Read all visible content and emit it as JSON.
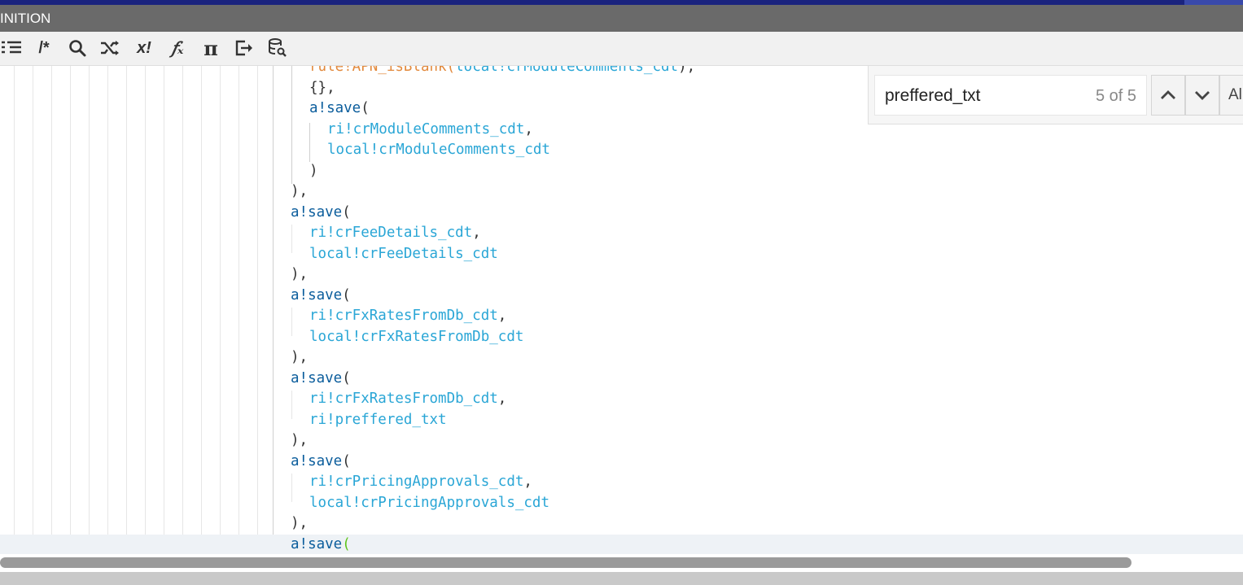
{
  "window": {
    "title": "INITION"
  },
  "toolbar": {
    "comment_label": "/*",
    "xbang_label": "x!",
    "fx_label": "𝑓ₓ",
    "pi_label": "π",
    "icons": [
      "outline-icon",
      "comment-icon",
      "search-icon",
      "shuffle-icon",
      "variable-icon",
      "function-icon",
      "pi-icon",
      "export-icon",
      "database-search-icon"
    ]
  },
  "find": {
    "query": "preffered_txt",
    "count": "5 of 5",
    "all_label": "All"
  },
  "editor": {
    "colors": {
      "keyword": "#0b5d9c",
      "variable": "#2aa6d6",
      "rule": "#e2893c",
      "punct": "#333333",
      "bracket_match": "#5ec41c"
    },
    "lines": [
      {
        "indent": 380,
        "tokens": [
          {
            "c": "r",
            "t": "rule!APN_isBlank("
          },
          {
            "c": "v",
            "t": "local!crModuleComments_cdt"
          },
          {
            "c": "p",
            "t": "),"
          }
        ]
      },
      {
        "indent": 380,
        "tokens": [
          {
            "c": "p",
            "t": "{},"
          }
        ]
      },
      {
        "indent": 380,
        "tokens": [
          {
            "c": "k",
            "t": "a!save"
          },
          {
            "c": "p",
            "t": "("
          }
        ]
      },
      {
        "indent": 402,
        "tokens": [
          {
            "c": "v",
            "t": "ri!crModuleComments_cdt"
          },
          {
            "c": "p",
            "t": ","
          }
        ]
      },
      {
        "indent": 402,
        "tokens": [
          {
            "c": "v",
            "t": "local!crModuleComments_cdt"
          }
        ]
      },
      {
        "indent": 380,
        "tokens": [
          {
            "c": "p",
            "t": ")"
          }
        ]
      },
      {
        "indent": 357,
        "tokens": [
          {
            "c": "p",
            "t": "),"
          }
        ]
      },
      {
        "indent": 357,
        "tokens": [
          {
            "c": "k",
            "t": "a!save"
          },
          {
            "c": "p",
            "t": "("
          }
        ]
      },
      {
        "indent": 380,
        "tokens": [
          {
            "c": "v",
            "t": "ri!crFeeDetails_cdt"
          },
          {
            "c": "p",
            "t": ","
          }
        ]
      },
      {
        "indent": 380,
        "tokens": [
          {
            "c": "v",
            "t": "local!crFeeDetails_cdt"
          }
        ]
      },
      {
        "indent": 357,
        "tokens": [
          {
            "c": "p",
            "t": "),"
          }
        ]
      },
      {
        "indent": 357,
        "tokens": [
          {
            "c": "k",
            "t": "a!save"
          },
          {
            "c": "p",
            "t": "("
          }
        ]
      },
      {
        "indent": 380,
        "tokens": [
          {
            "c": "v",
            "t": "ri!crFxRatesFromDb_cdt"
          },
          {
            "c": "p",
            "t": ","
          }
        ]
      },
      {
        "indent": 380,
        "tokens": [
          {
            "c": "v",
            "t": "local!crFxRatesFromDb_cdt"
          }
        ]
      },
      {
        "indent": 357,
        "tokens": [
          {
            "c": "p",
            "t": "),"
          }
        ]
      },
      {
        "indent": 357,
        "tokens": [
          {
            "c": "k",
            "t": "a!save"
          },
          {
            "c": "p",
            "t": "("
          }
        ]
      },
      {
        "indent": 380,
        "tokens": [
          {
            "c": "v",
            "t": "ri!crFxRatesFromDb_cdt"
          },
          {
            "c": "p",
            "t": ","
          }
        ]
      },
      {
        "indent": 380,
        "tokens": [
          {
            "c": "v",
            "t": "ri!preffered_txt"
          }
        ]
      },
      {
        "indent": 357,
        "tokens": [
          {
            "c": "p",
            "t": "),"
          }
        ]
      },
      {
        "indent": 357,
        "tokens": [
          {
            "c": "k",
            "t": "a!save"
          },
          {
            "c": "p",
            "t": "("
          }
        ]
      },
      {
        "indent": 380,
        "tokens": [
          {
            "c": "v",
            "t": "ri!crPricingApprovals_cdt"
          },
          {
            "c": "p",
            "t": ","
          }
        ]
      },
      {
        "indent": 380,
        "tokens": [
          {
            "c": "v",
            "t": "local!crPricingApprovals_cdt"
          }
        ]
      },
      {
        "indent": 357,
        "tokens": [
          {
            "c": "p",
            "t": "),"
          }
        ]
      },
      {
        "indent": 357,
        "active": true,
        "tokens": [
          {
            "c": "k",
            "t": "a!save"
          },
          {
            "c": "bm",
            "t": "("
          }
        ]
      }
    ]
  }
}
